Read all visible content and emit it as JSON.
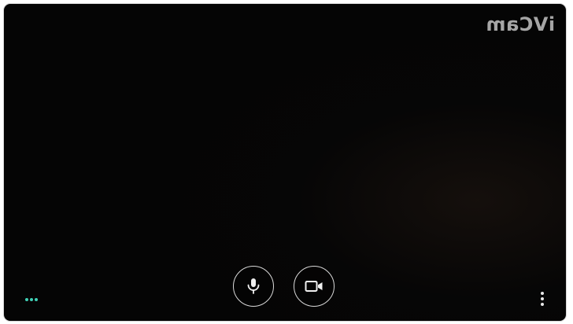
{
  "video": {
    "watermark_text": "iVCam",
    "watermark_mirrored": true
  },
  "controls": {
    "microphone": {
      "icon": "microphone-icon"
    },
    "camera": {
      "icon": "video-camera-icon"
    }
  },
  "status": {
    "indicator_icon": "three-dots-indicator",
    "indicator_color": "#3fd0b5"
  },
  "menu": {
    "icon": "more-vert-icon"
  },
  "colors": {
    "background": "#050505",
    "control_border": "#d9d9d9",
    "icon": "#f0f0f0"
  }
}
